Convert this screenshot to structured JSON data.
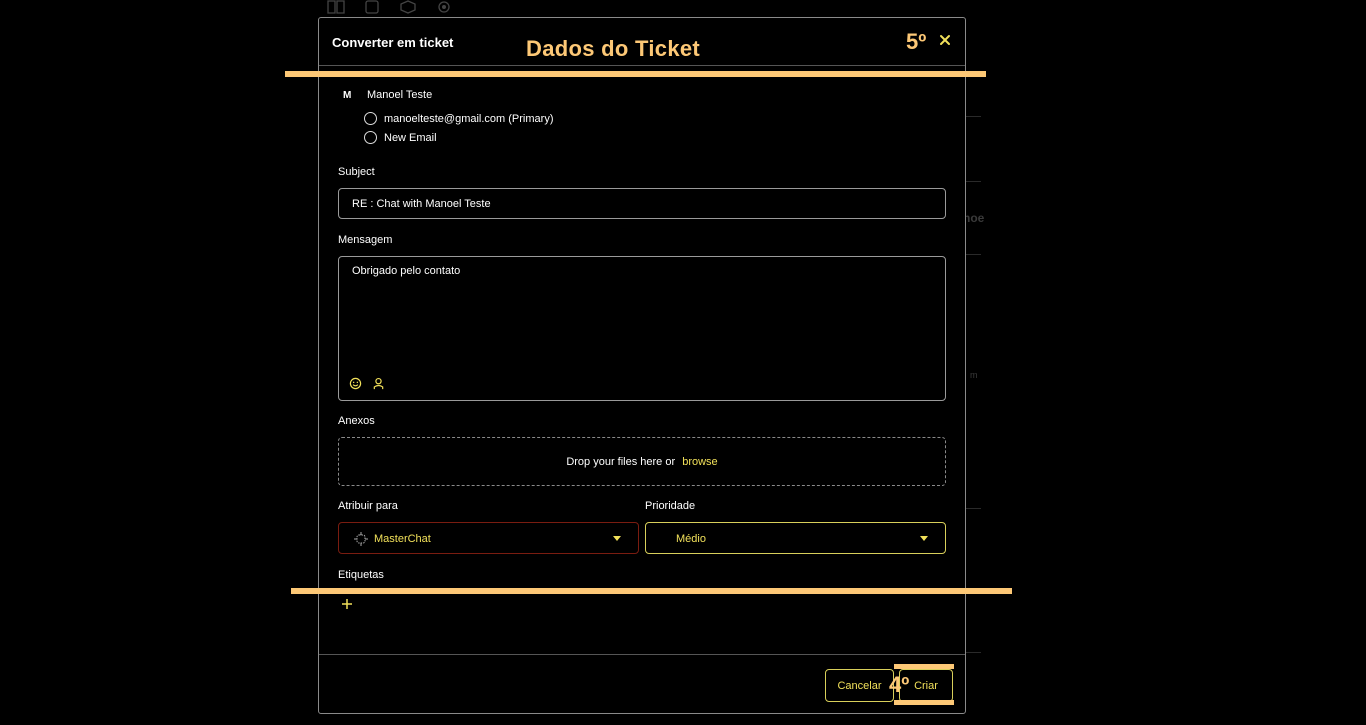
{
  "modal": {
    "title": "Converter em ticket",
    "contact": {
      "initial": "M",
      "name": "Manoel Teste",
      "email_options": [
        "manoelteste@gmail.com (Primary)",
        "New Email"
      ]
    },
    "subject": {
      "label": "Subject",
      "value": "RE : Chat with Manoel Teste"
    },
    "message": {
      "label": "Mensagem",
      "value": "Obrigado pelo contato"
    },
    "attachments": {
      "label": "Anexos",
      "drop_text": "Drop your files here or",
      "browse_text": "browse"
    },
    "assign": {
      "label": "Atribuir para",
      "value": "MasterChat"
    },
    "priority": {
      "label": "Prioridade",
      "value": "Médio"
    },
    "tags": {
      "label": "Etiquetas"
    },
    "footer": {
      "cancel_label": "Cancelar",
      "create_label": "Criar"
    }
  },
  "annotations": {
    "title": "Dados do Ticket",
    "step_top": "5º",
    "step_bottom": "4º",
    "color": "#fdc876"
  },
  "theme": {
    "accent": "#f1e05a",
    "assign_border": "#7a1c10"
  },
  "background": {
    "side_text_1": "noe",
    "side_text_2": "m"
  }
}
